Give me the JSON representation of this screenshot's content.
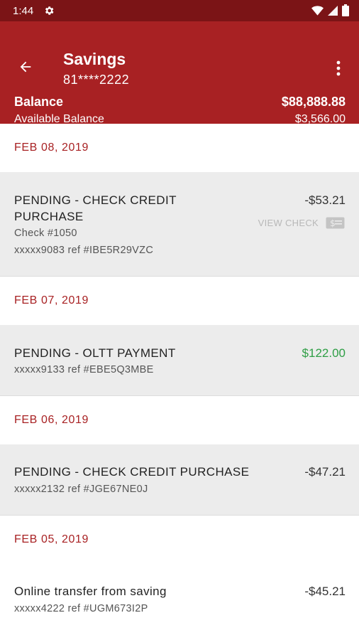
{
  "status": {
    "time": "1:44"
  },
  "header": {
    "title": "Savings",
    "account": "81****2222",
    "balance_label": "Balance",
    "balance_value": "$88,888.88",
    "available_label": "Available Balance",
    "available_value": "$3,566.00"
  },
  "groups": [
    {
      "date": "FEB 08, 2019"
    },
    {
      "date": "FEB 07, 2019"
    },
    {
      "date": "FEB 06, 2019"
    },
    {
      "date": "FEB 05, 2019"
    }
  ],
  "transactions": [
    {
      "desc_line1": "PENDING - CHECK CREDIT",
      "desc_line2": "PURCHASE",
      "check": "Check #1050",
      "ref": "xxxxx9083 ref #IBE5R29VZC",
      "amount": "-$53.21",
      "action": "VIEW CHECK"
    },
    {
      "desc": "PENDING - OLTT PAYMENT",
      "ref": "xxxxx9133 ref #EBE5Q3MBE",
      "amount": "$122.00"
    },
    {
      "desc": "PENDING - CHECK CREDIT PURCHASE",
      "ref": "xxxxx2132 ref #JGE67NE0J",
      "amount": "-$47.21"
    },
    {
      "desc": "Online transfer from saving",
      "ref": "xxxxx4222 ref #UGM673I2P",
      "amount": "-$45.21"
    }
  ],
  "colors": {
    "brand": "#a82123",
    "status_bar": "#7b1416",
    "credit": "#2e9e45"
  }
}
